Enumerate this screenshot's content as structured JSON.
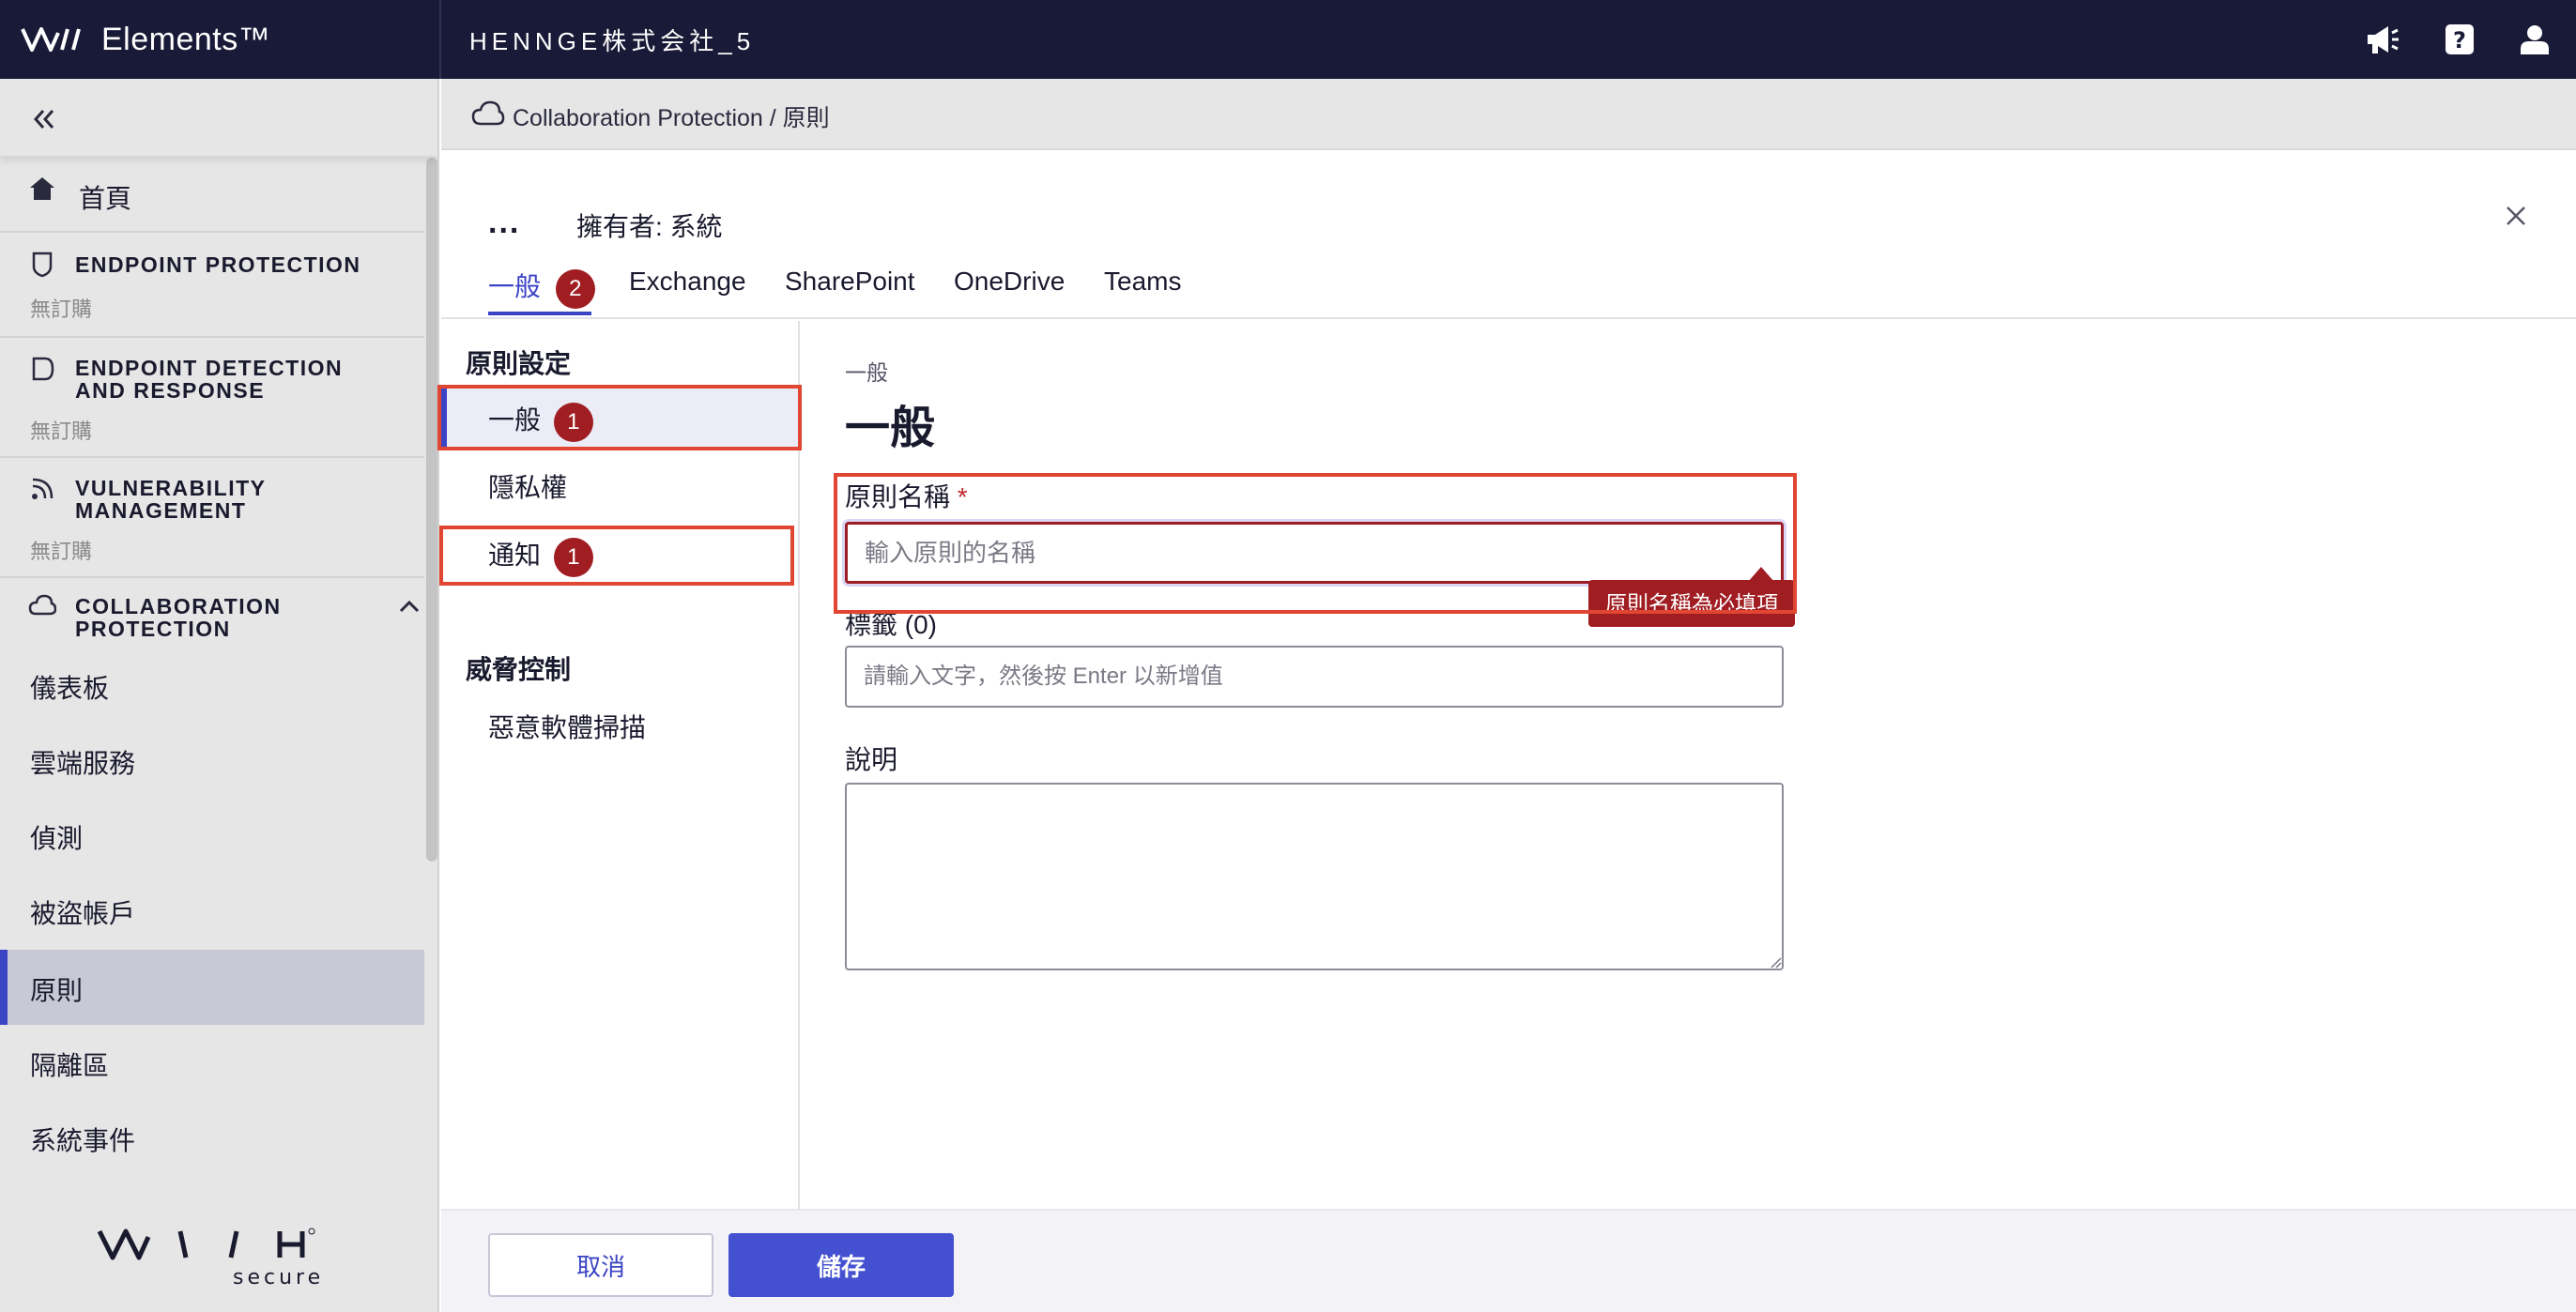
{
  "topbar": {
    "brand": "Elements™",
    "org_name": "HENNGE株式会社_5",
    "icons": [
      "megaphone-icon",
      "help-icon",
      "user-icon"
    ]
  },
  "sidebar": {
    "home": "首頁",
    "products": [
      {
        "label": "ENDPOINT PROTECTION",
        "sub": "無訂購",
        "icon": "shield-icon"
      },
      {
        "label": "ENDPOINT DETECTION AND RESPONSE",
        "sub": "無訂購",
        "icon": "edr-icon"
      },
      {
        "label": "VULNERABILITY MANAGEMENT",
        "sub": "無訂購",
        "icon": "radar-icon"
      },
      {
        "label": "COLLABORATION PROTECTION",
        "sub": "",
        "icon": "cloud-icon"
      }
    ],
    "links": [
      "儀表板",
      "雲端服務",
      "偵測",
      "被盜帳戶",
      "原則",
      "隔離區",
      "系統事件"
    ],
    "active_link": "原則",
    "footer_logo": "WITH secure"
  },
  "breadcrumb": {
    "text": "Collaboration Protection / 原則"
  },
  "header": {
    "more": "...",
    "owner": "擁有者: 系統",
    "tabs": [
      {
        "label": "一般",
        "badge": "2",
        "active": true
      },
      {
        "label": "Exchange"
      },
      {
        "label": "SharePoint"
      },
      {
        "label": "OneDrive"
      },
      {
        "label": "Teams"
      }
    ]
  },
  "settings_nav": {
    "section1": "原則設定",
    "items1": [
      {
        "label": "一般",
        "badge": "1",
        "selected": true
      },
      {
        "label": "隱私權"
      },
      {
        "label": "通知",
        "badge": "1"
      }
    ],
    "section2": "威脅控制",
    "items2": [
      {
        "label": "惡意軟體掃描"
      }
    ]
  },
  "form": {
    "breadcrumb": "一般",
    "title": "一般",
    "name_label": "原則名稱",
    "required_mark": "*",
    "name_placeholder": "輸入原則的名稱",
    "name_error": "原則名稱為必填項",
    "tags_label": "標籤 (0)",
    "tags_placeholder": "請輸入文字，然後按 Enter 以新增值",
    "description_label": "說明"
  },
  "footer": {
    "cancel": "取消",
    "save": "儲存"
  },
  "colors": {
    "topbar_bg": "#191a37",
    "accent": "#3b44c4",
    "error": "#a01d22",
    "highlight_frame": "#e04632"
  }
}
